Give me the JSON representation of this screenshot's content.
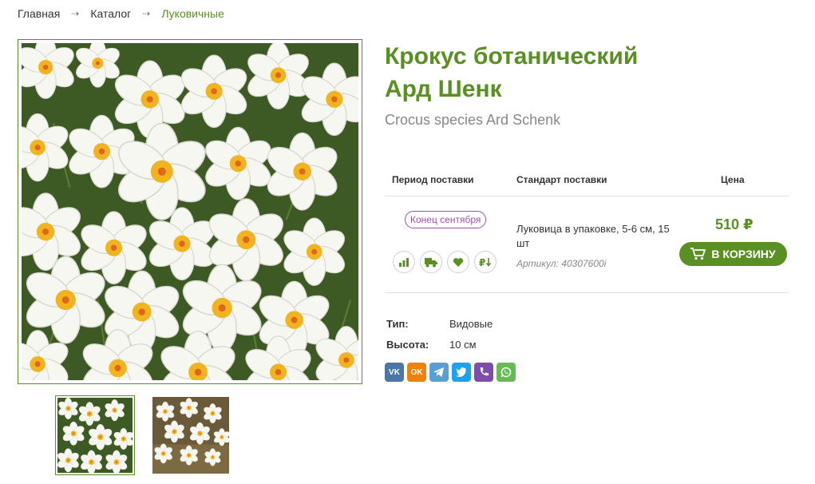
{
  "breadcrumb": {
    "home": "Главная",
    "catalog": "Каталог",
    "current": "Луковичные",
    "separator": "⇢"
  },
  "product": {
    "title_line1": "Крокус ботанический",
    "title_line2": "Ард Шенк",
    "latin_name": "Crocus species Ard Schenk"
  },
  "table": {
    "headers": {
      "period": "Период поставки",
      "standard": "Стандарт поставки",
      "price": "Цена"
    },
    "row": {
      "period": "Конец сентября",
      "description": "Луковица в упаковке, 5-6 см, 15 шт",
      "sku": "Артикул: 40307600i",
      "price": "510 ₽",
      "cart_label": "В КОРЗИНУ"
    },
    "icons": [
      "bar-chart-icon",
      "truck-icon",
      "heart-icon",
      "sort-price-icon"
    ]
  },
  "properties": [
    {
      "name": "Тип:",
      "value": "Видовые"
    },
    {
      "name": "Высота:",
      "value": "10 см"
    }
  ],
  "share": {
    "vk": {
      "label": "VK",
      "color": "#4a76a8"
    },
    "ok": {
      "label": "OK",
      "color": "#ee8208"
    },
    "telegram": {
      "color": "#5a9fd4"
    },
    "twitter": {
      "color": "#1da1f2"
    },
    "viber": {
      "color": "#7d4daa"
    },
    "whatsapp": {
      "color": "#65bc54"
    }
  },
  "colors": {
    "accent": "#5a8f23",
    "period_badge": "#a04fb5"
  }
}
